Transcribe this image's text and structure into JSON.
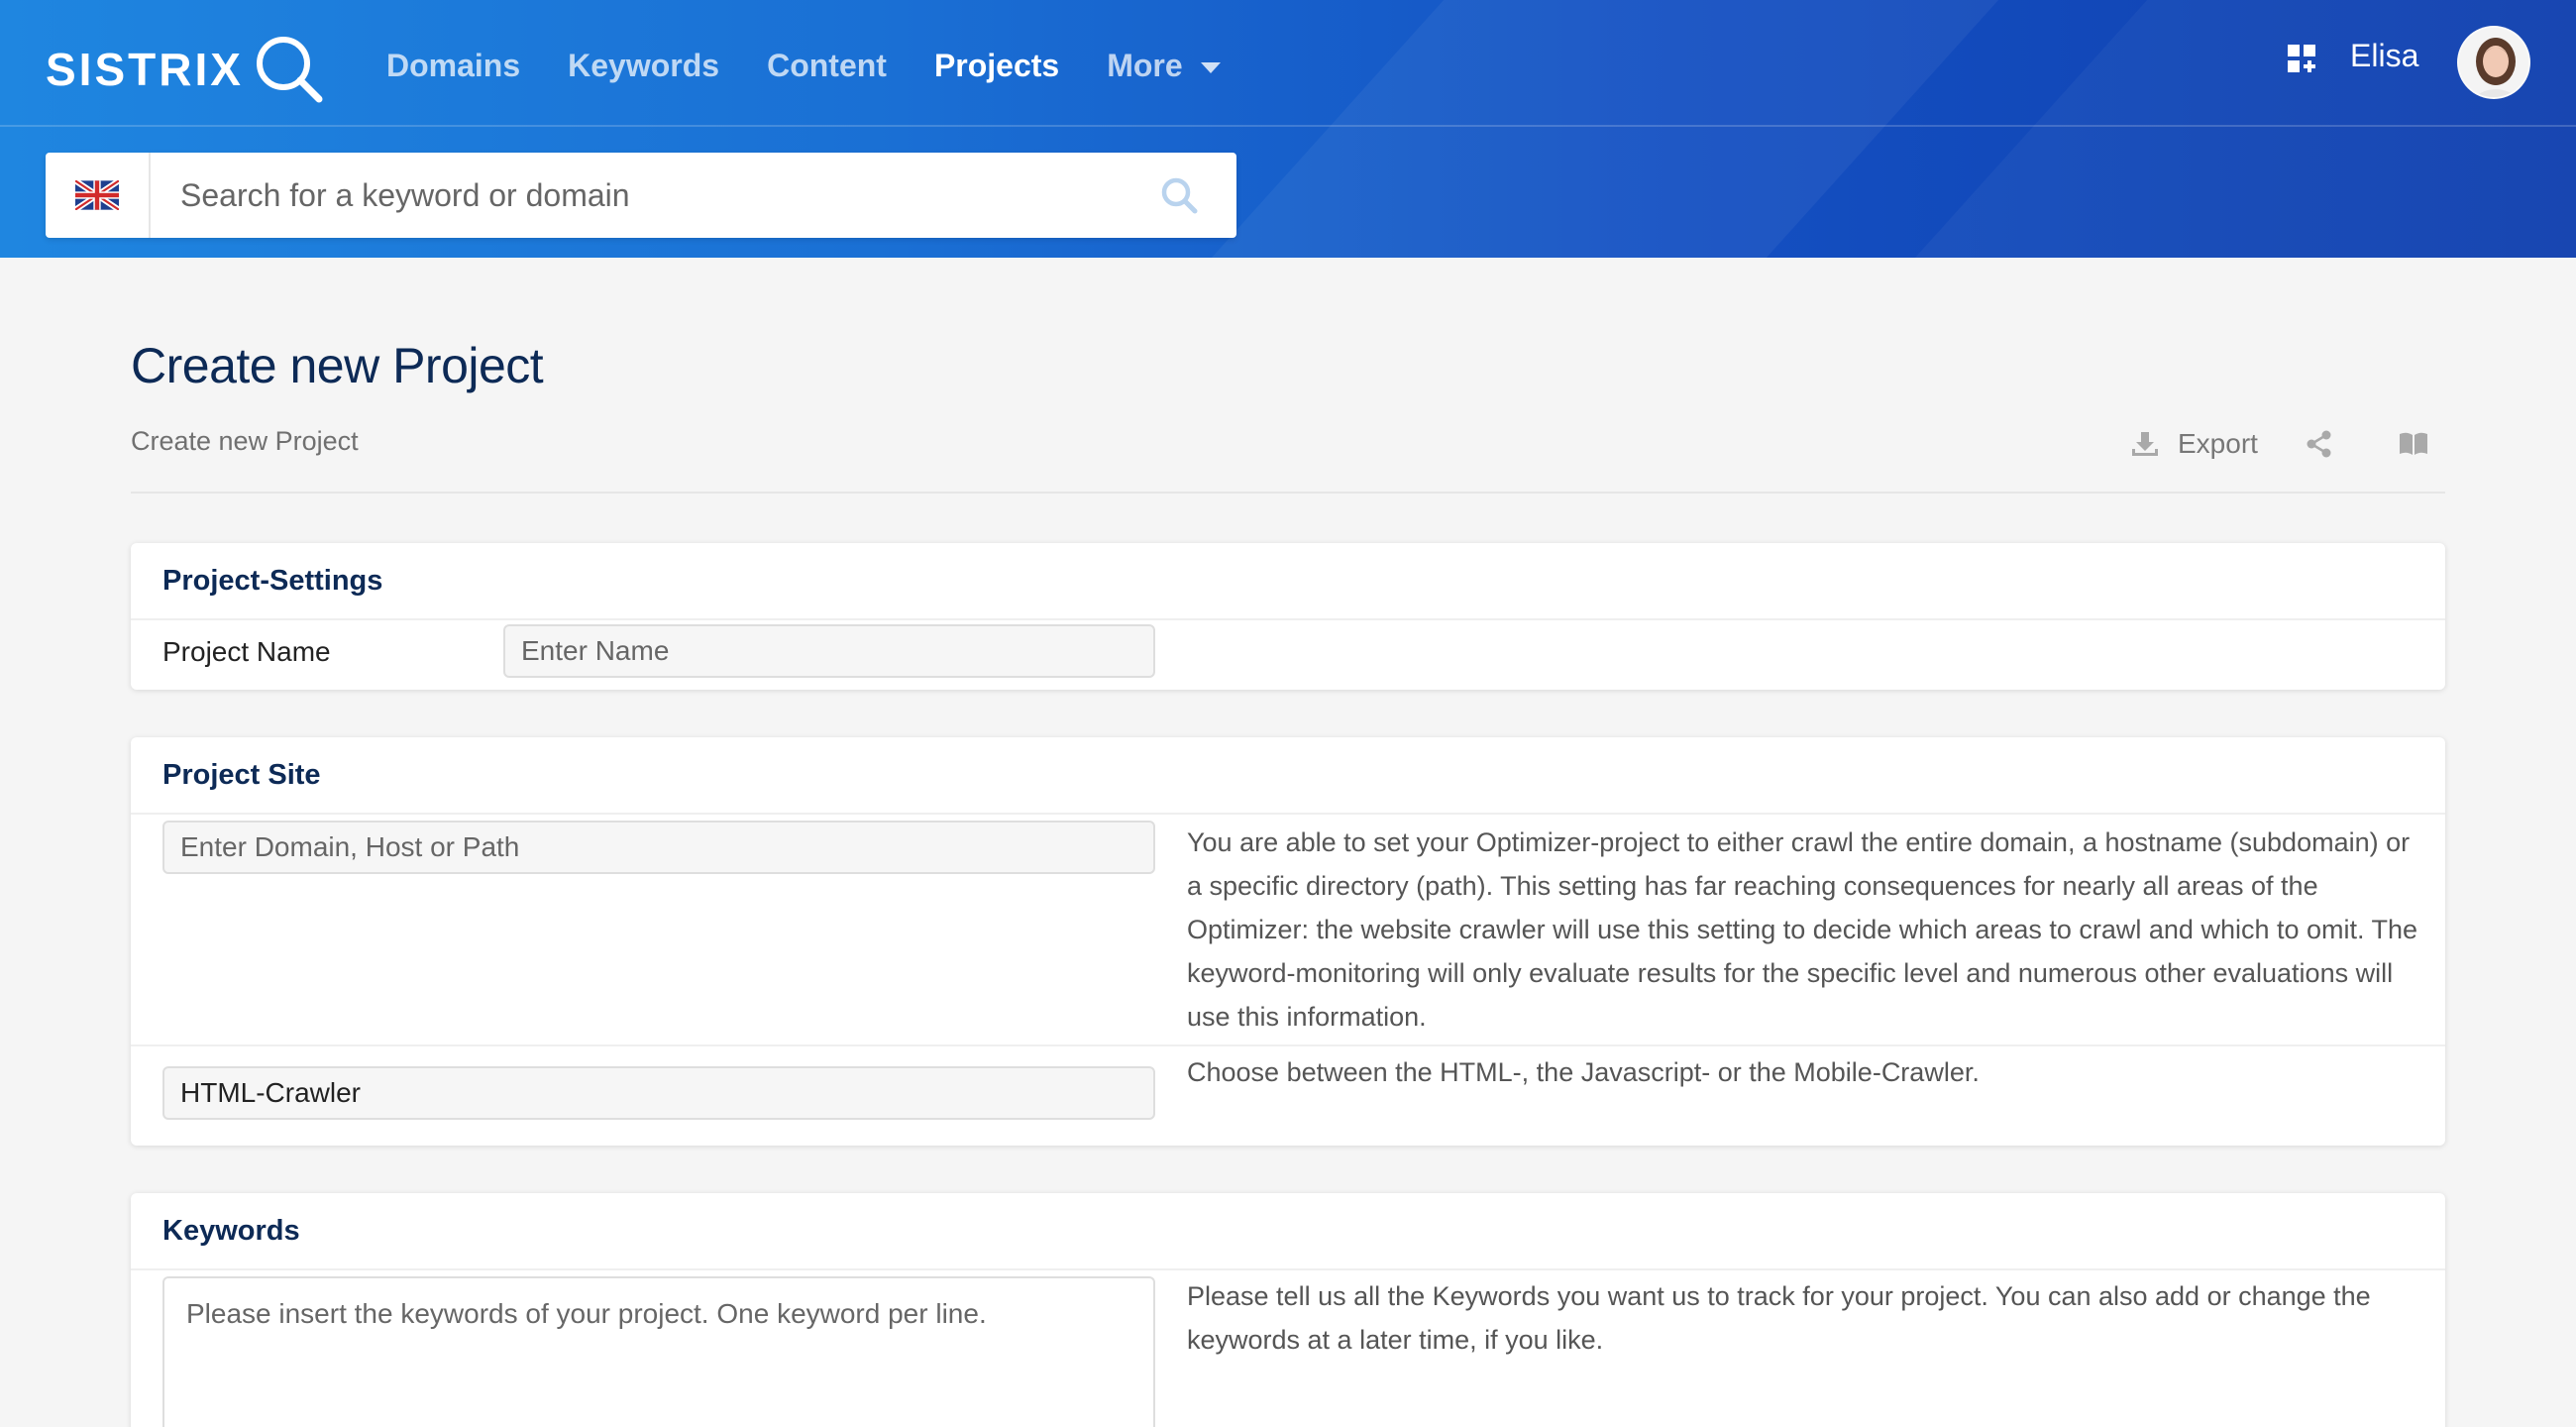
{
  "brand": {
    "name": "SISTRIX"
  },
  "nav": {
    "items": [
      {
        "label": "Domains",
        "active": false
      },
      {
        "label": "Keywords",
        "active": false
      },
      {
        "label": "Content",
        "active": false
      },
      {
        "label": "Projects",
        "active": true
      },
      {
        "label": "More",
        "active": false,
        "has_dropdown": true
      }
    ]
  },
  "user": {
    "name": "Elisa"
  },
  "search": {
    "placeholder": "Search for a keyword or domain",
    "country_flag": "uk-flag-icon"
  },
  "page": {
    "title": "Create new Project",
    "breadcrumb": "Create new Project",
    "tools": {
      "export_label": "Export"
    }
  },
  "sections": {
    "project_settings": {
      "title": "Project-Settings",
      "name_label": "Project Name",
      "name_placeholder": "Enter Name"
    },
    "project_site": {
      "title": "Project Site",
      "domain_placeholder": "Enter Domain, Host or Path",
      "domain_help": "You are able to set your Optimizer-project to either crawl the entire domain, a hostname (subdomain) or a specific directory (path). This setting has far reaching consequences for nearly all areas of the Optimizer: the website crawler will use this setting to decide which areas to crawl and which to omit. The keyword-monitoring will only evaluate results for the specific level and numerous other evaluations will use this information.",
      "crawler_value": "HTML-Crawler",
      "crawler_help": "Choose between the HTML-, the Javascript- or the Mobile-Crawler."
    },
    "keywords": {
      "title": "Keywords",
      "textarea_placeholder": "Please insert the keywords of your project. One keyword per line.",
      "help": "Please tell us all the Keywords you want us to track for your project. You can also add or change the keywords at a later time, if you like."
    }
  },
  "colors": {
    "header_start": "#1f86e0",
    "header_end": "#0f3fae",
    "title_navy": "#0d2a56",
    "background": "#f5f5f5"
  }
}
